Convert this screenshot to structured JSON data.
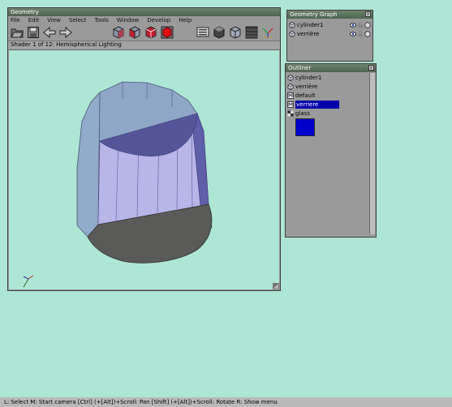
{
  "geometry_window": {
    "title": "Geometry",
    "menu": [
      "File",
      "Edit",
      "View",
      "Select",
      "Tools",
      "Window",
      "Develop",
      "Help"
    ],
    "toolbar_icons": [
      "open-folder-icon",
      "save-disk-icon",
      "back-arrow-icon",
      "forward-arrow-icon",
      "cube-shaded-icon",
      "cube-red-icon",
      "cube-wire-red-icon",
      "cube-solid-red-icon",
      "screen-icon",
      "sphere-icon",
      "cube-gray-icon",
      "texture-icon",
      "axes-icon"
    ],
    "shader_label": "Shader 1 of 12: Hemispherical Lighting"
  },
  "geometry_graph": {
    "title": "Geometry Graph",
    "close": "x",
    "items": [
      {
        "label": "cylinder1",
        "icon": "node-icon"
      },
      {
        "label": "verrière",
        "icon": "node-icon"
      }
    ]
  },
  "outliner": {
    "title": "Outliner",
    "close": "x",
    "items": [
      {
        "label": "cylinder1",
        "icon": "node-icon",
        "selected": false
      },
      {
        "label": "verrière",
        "icon": "node-icon",
        "selected": false
      },
      {
        "label": "default",
        "icon": "material-icon",
        "selected": false
      },
      {
        "label": "verriere",
        "icon": "material-icon",
        "selected": true
      },
      {
        "label": "glass",
        "icon": "texture-icon",
        "selected": false
      }
    ],
    "swatch_color": "#0000cc"
  },
  "statusbar": {
    "text": "L: Select   M: Start camera   [Ctrl] (+[Alt])+Scroll: Pan   [Shift] (+[Alt])+Scroll: Rotate   R: Show menu"
  },
  "colors": {
    "background": "#aee6d6",
    "panel": "#9a9a9a",
    "selection": "#0000aa"
  }
}
